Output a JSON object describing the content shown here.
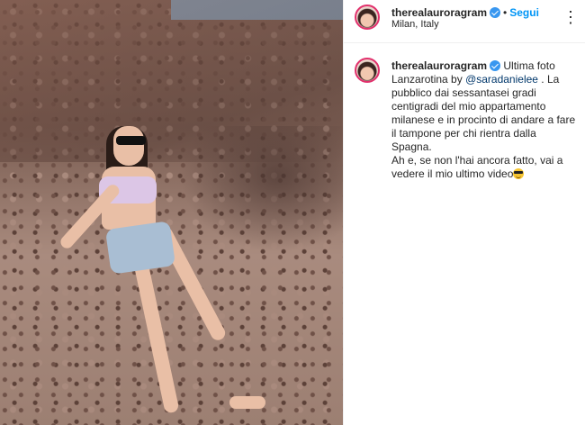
{
  "post": {
    "header": {
      "username": "therealauroragram",
      "verified": true,
      "separator": "•",
      "follow_label": "Segui",
      "location": "Milan, Italy",
      "more_icon": "more-options-icon"
    },
    "caption": {
      "username": "therealauroragram",
      "verified": true,
      "text_before_mention": "Ultima foto Lanzarotina by ",
      "mention": "@saradanielee",
      "text_after_mention": " . La pubblico dai sessantasei gradi centigradi del mio appartamento milanese e in procinto di andare a fare il tampone per chi rientra dalla Spagna.",
      "line2": "Ah e, se non l'hai ancora fatto, vai a vedere il mio ultimo video",
      "emoji": "sunglasses-emoji"
    },
    "colors": {
      "accent_link": "#0095f6",
      "mention": "#00376b",
      "verified_badge": "#3897f0",
      "text": "#262626"
    }
  }
}
